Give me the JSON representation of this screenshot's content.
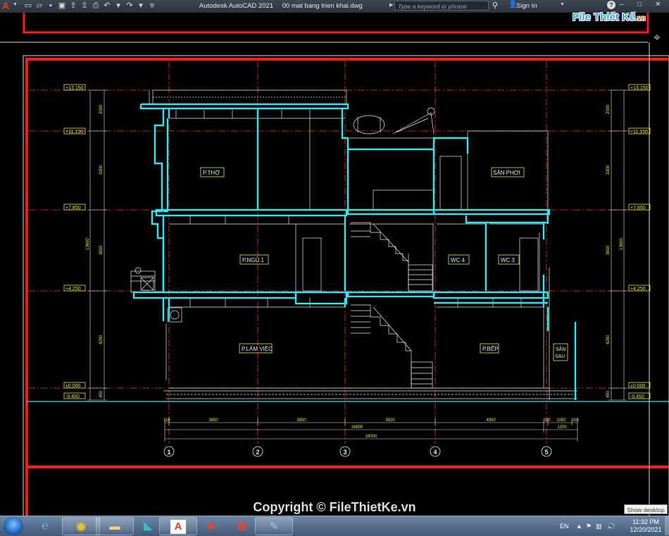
{
  "titlebar": {
    "app_logo": "A",
    "title_app": "Autodesk AutoCAD 2021",
    "title_file": "00 mat bang trien khai.dwg",
    "search_placeholder": "Type a keyword or phrase",
    "signin": "Sign In",
    "help": "?"
  },
  "watermark": {
    "logo_main": "File Thiết Kế",
    "logo_tld": ".vn"
  },
  "copyright": "Copyright © FileThietKe.vn",
  "show_desktop": "Show desktop",
  "tray": {
    "lang": "EN",
    "time": "11:32 PM",
    "date": "12/20/2021"
  },
  "taskbar_apps": [
    "internet-explorer",
    "chrome",
    "file-explorer",
    "autocad-app",
    "autocad",
    "sketchup",
    "layout",
    "paint"
  ],
  "drawing": {
    "levels_left": [
      "+13.150",
      "+11.150",
      "+7.850",
      "+4.250",
      "±0.000",
      "-0.450"
    ],
    "levels_right": [
      "+13.150",
      "+11.150",
      "+7.850",
      "+4.250",
      "±0.000",
      "-0.450"
    ],
    "dims_vertical_left": [
      "2000",
      "3300",
      "3600",
      "4250",
      "450",
      "13600"
    ],
    "dims_vertical_right": [
      "2000",
      "3300",
      "3600",
      "4250",
      "450",
      "13600"
    ],
    "rooms": {
      "p_tho": "P.THỜ",
      "san_phoi": "SÂN PHƠI",
      "p_ngu_1": "P.NGỦ 1",
      "wc4": "WC 4",
      "wc3": "WC 3",
      "p_lam_viec": "P.LÀM VIỆC",
      "p_bep": "P.BẾP",
      "san_sau_1": "SÂN",
      "san_sau_2": "SAU"
    },
    "dims_bottom_row1": [
      "110",
      "3850",
      "3850",
      "3920",
      "4900",
      "110",
      "1050",
      "110"
    ],
    "dims_bottom_row2": [
      "16800",
      "1200"
    ],
    "dims_bottom_row3": [
      "18000"
    ],
    "axes": [
      "1",
      "2",
      "3",
      "4",
      "5"
    ]
  },
  "colors": {
    "wall": "#2ee6f0",
    "frame": "#ff1a1a",
    "line": "#e8e8e8",
    "label": "#e8e83c",
    "dim": "#e8e83c",
    "grid": "#ff3030"
  }
}
